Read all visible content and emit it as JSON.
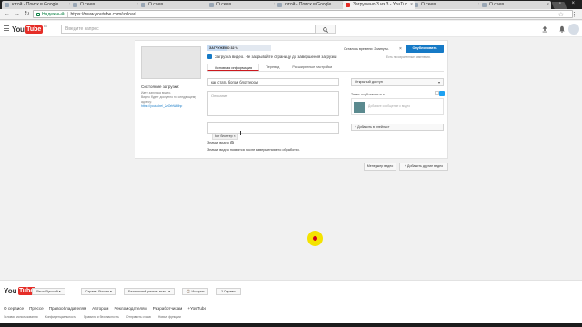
{
  "browser": {
    "tabs": [
      {
        "label": "ютой - Поиск в Google",
        "icon": "globe-icon",
        "active": false
      },
      {
        "label": "О сеев",
        "icon": "globe-icon",
        "active": false
      },
      {
        "label": "О сеев",
        "icon": "globe-icon",
        "active": false
      },
      {
        "label": "О сеев",
        "icon": "globe-icon",
        "active": false
      },
      {
        "label": "ютой - Поиск в Google",
        "icon": "globe-icon",
        "active": false
      },
      {
        "label": "Загружено 3 из 3 - YouTube",
        "icon": "youtube-icon",
        "active": true
      },
      {
        "label": "О сеев",
        "icon": "globe-icon",
        "active": false
      },
      {
        "label": "О сеев",
        "icon": "globe-icon",
        "active": false
      }
    ],
    "secure_label": "Надежный",
    "url": "https://www.youtube.com/upload"
  },
  "youtube": {
    "logo_you": "You",
    "logo_tube": "Tube",
    "logo_cc": "RU",
    "search_placeholder": "Введите запрос"
  },
  "upload": {
    "status_title": "Состояние загрузки:",
    "status_line1": "Идет загрузка видео.",
    "status_line2": "Видео будет доступно по следующему адресу:",
    "status_link": "https://youtu.be/_ZzOrbWMhp",
    "progress_text": "ЗАГРУЖЕНО 32 %",
    "progress_value": 0.32,
    "time_left": "Осталось времени: 2 минуты.",
    "publish_label": "Опубликовать",
    "saved_note": "Есть несохраненные изменения.",
    "warning": "Загрузка видео. Не закрывайте страницу до завершения загрузки",
    "tabs": [
      "Основная информация",
      "Перевод",
      "Расширенные настройки"
    ],
    "title_value": "как стать богом блоттером",
    "description_placeholder": "Описание",
    "tag": "бог блоттер",
    "access": "Открытый доступ",
    "share_label": "Также опубликовать в",
    "share_placeholder": "Добавьте сообщение к видео",
    "playlist_label": "+ Добавить в плейлист",
    "video_icons_label": "Значки видео",
    "video_icons_note": "Значки видео появятся после завершения его обработки."
  },
  "actions": {
    "manager_label": "Менеджер видео",
    "add_more_label": "+ Добавить другие видео"
  },
  "footer": {
    "language": "Язык: Русский",
    "country": "Страна: Россия",
    "safe_mode": "Безопасный режим: выкл.",
    "history": "История",
    "help": "Справка",
    "links": [
      "О сервисе",
      "Прессе",
      "Правообладателям",
      "Авторам",
      "Рекламодателям",
      "Разработчикам",
      "+YouTube"
    ],
    "links2": [
      "Условия использования",
      "Конфиденциальность",
      "Правила и безопасность",
      "Отправить отзыв",
      "Новые функции"
    ]
  },
  "colors": {
    "accent": "#167ac6",
    "brand_red": "#e52d27"
  }
}
